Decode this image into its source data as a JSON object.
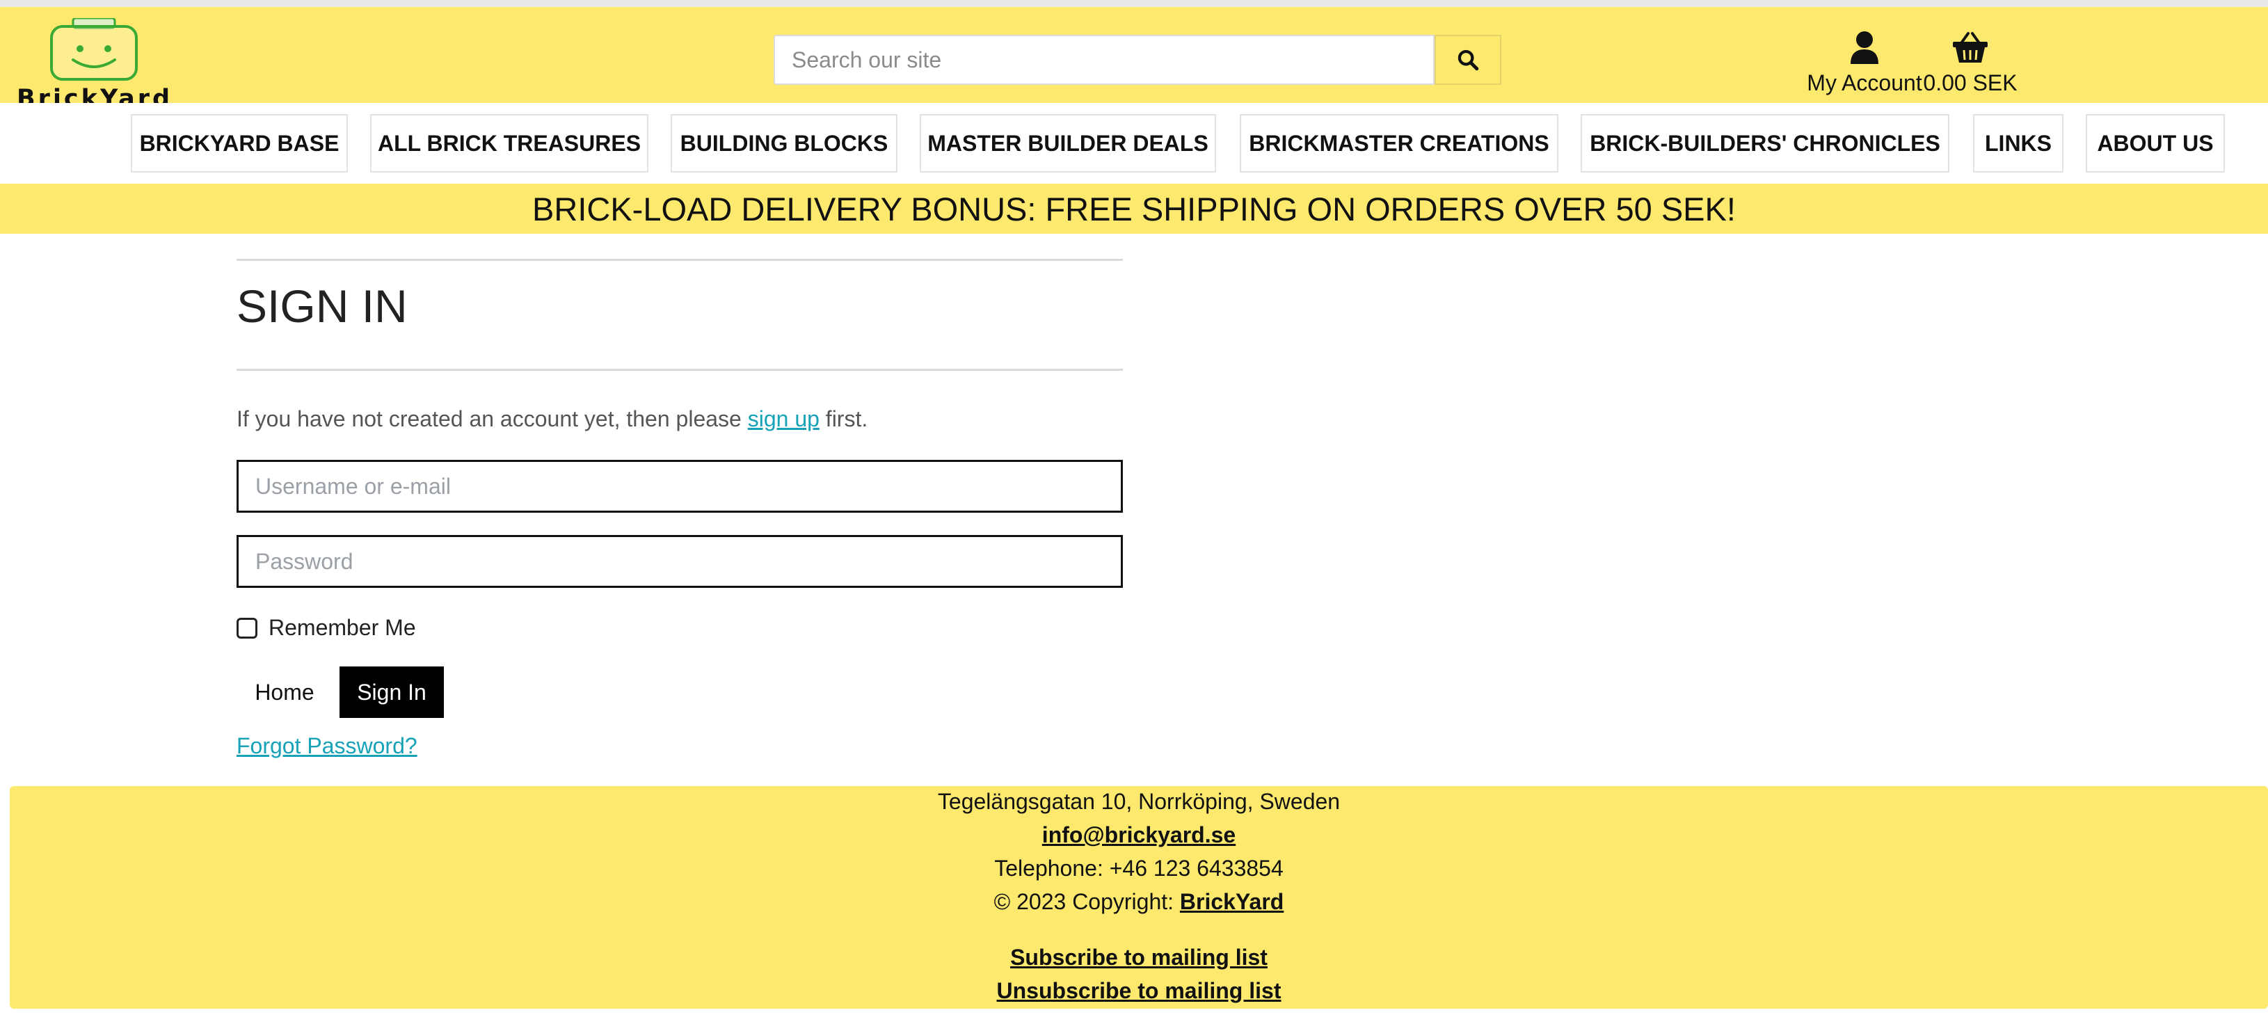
{
  "brand": {
    "name": "BrickYard"
  },
  "search": {
    "placeholder": "Search our site"
  },
  "header": {
    "account_label": "My Account",
    "cart_total": "0.00 SEK"
  },
  "nav": [
    "BRICKYARD BASE",
    "ALL BRICK TREASURES",
    "BUILDING BLOCKS",
    "MASTER BUILDER DEALS",
    "BRICKMASTER CREATIONS",
    "BRICK-BUILDERS' CHRONICLES",
    "LINKS",
    "ABOUT US"
  ],
  "promo": {
    "text": "BRICK-LOAD DELIVERY BONUS: FREE SHIPPING ON ORDERS OVER 50 SEK!"
  },
  "signin": {
    "title": "SIGN IN",
    "intro_before": "If you have not created an account yet, then please ",
    "intro_link": "sign up",
    "intro_after": " first.",
    "username_placeholder": "Username or e-mail",
    "password_placeholder": "Password",
    "remember_label": "Remember Me",
    "home_button": "Home",
    "signin_button": "Sign In",
    "forgot_link": "Forgot Password?"
  },
  "footer": {
    "address": "Tegelängsgatan 10, Norrköping, Sweden",
    "email": "info@brickyard.se",
    "telephone": "Telephone: +46 123 6433854",
    "copyright_prefix": "© 2023 Copyright: ",
    "copyright_link": "BrickYard",
    "subscribe": "Subscribe to mailing list",
    "unsubscribe": "Unsubscribe to mailing list"
  },
  "colors": {
    "brand_yellow": "#fde96d",
    "link_teal": "#17a2b8",
    "logo_green": "#3aaa35"
  },
  "icons": [
    "lego-head-logo-icon",
    "search-icon",
    "user-icon",
    "basket-icon"
  ]
}
